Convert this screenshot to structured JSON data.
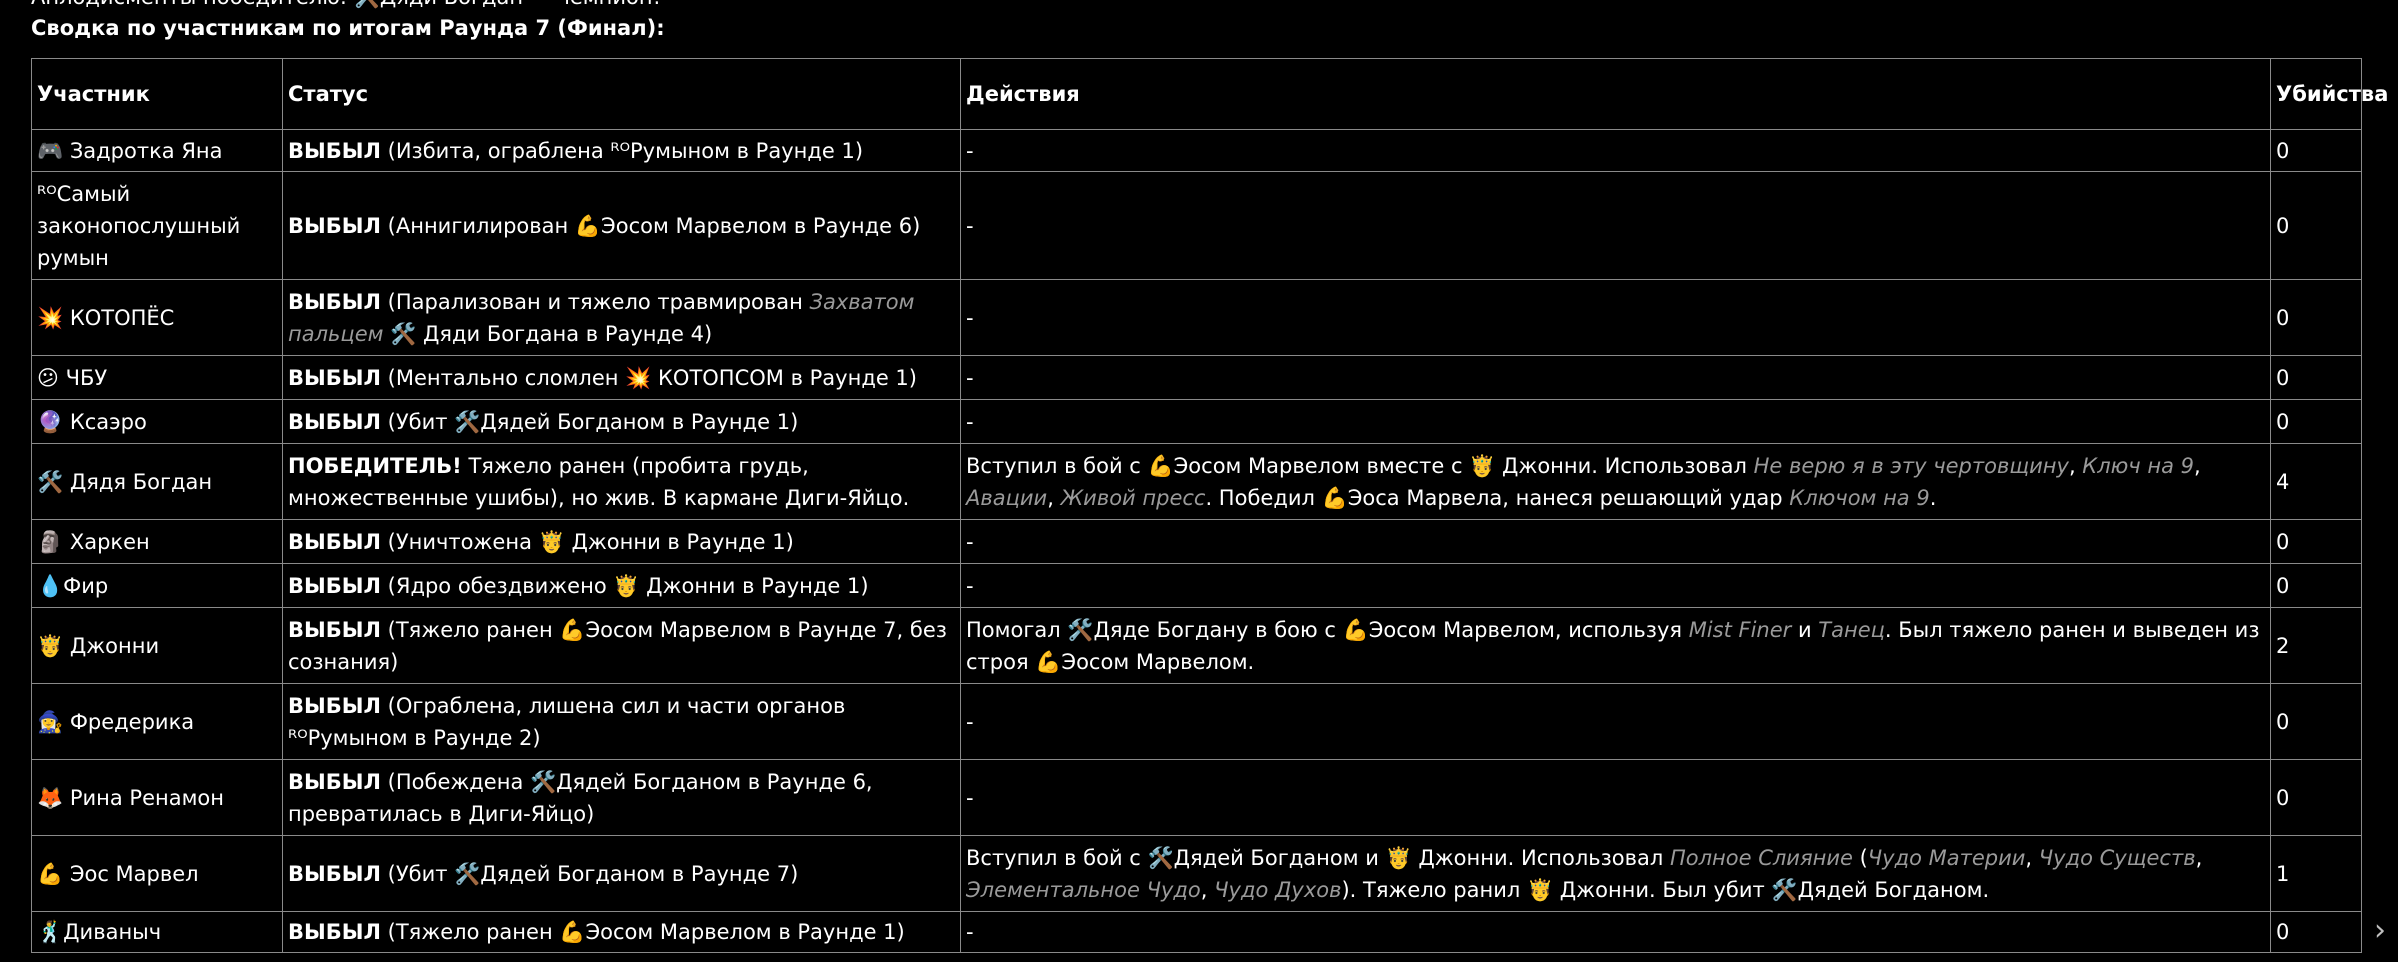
{
  "header": {
    "top_line": "Аплодисменты победителю: 🛠️Дяди Богдан — чемпион!",
    "summary_title": "Сводка по участникам по итогам Раунда 7 (Финал):"
  },
  "table": {
    "columns": [
      "Участник",
      "Статус",
      "Действия",
      "Убийства"
    ],
    "rows": [
      {
        "name": "🎮 Задротка Яна",
        "status": [
          {
            "t": "ВЫБЫЛ",
            "s": "b"
          },
          {
            "t": " (Избита, ограблена ᴿᴼРумыном в Раунде 1)",
            "s": ""
          }
        ],
        "actions": [
          {
            "t": "-",
            "s": ""
          }
        ],
        "kills": "0"
      },
      {
        "name": "ᴿᴼСамый законопослушный румын",
        "status": [
          {
            "t": "ВЫБЫЛ",
            "s": "b"
          },
          {
            "t": " (Аннигилирован 💪Эосом Марвелом в Раунде 6)",
            "s": ""
          }
        ],
        "actions": [
          {
            "t": "-",
            "s": ""
          }
        ],
        "kills": "0"
      },
      {
        "name": "💥 КОТОПЁС",
        "status": [
          {
            "t": "ВЫБЫЛ",
            "s": "b"
          },
          {
            "t": " (Парализован и тяжело травмирован ",
            "s": ""
          },
          {
            "t": "Захватом пальцем",
            "s": "i"
          },
          {
            "t": " 🛠️ Дяди Богдана в Раунде 4)",
            "s": ""
          }
        ],
        "actions": [
          {
            "t": "-",
            "s": ""
          }
        ],
        "kills": "0"
      },
      {
        "name": "😕 ЧБУ",
        "status": [
          {
            "t": "ВЫБЫЛ",
            "s": "b"
          },
          {
            "t": " (Ментально сломлен 💥 КОТОПСОМ в Раунде 1)",
            "s": ""
          }
        ],
        "actions": [
          {
            "t": "-",
            "s": ""
          }
        ],
        "kills": "0"
      },
      {
        "name": "🔮 Ксаэро",
        "status": [
          {
            "t": "ВЫБЫЛ",
            "s": "b"
          },
          {
            "t": " (Убит 🛠️Дядей Богданом в Раунде 1)",
            "s": ""
          }
        ],
        "actions": [
          {
            "t": "-",
            "s": ""
          }
        ],
        "kills": "0"
      },
      {
        "name": "🛠️ Дядя Богдан",
        "status": [
          {
            "t": "ПОБЕДИТЕЛЬ!",
            "s": "b"
          },
          {
            "t": " Тяжело ранен (пробита грудь, множественные ушибы), но жив. В кармане Диги-Яйцо.",
            "s": ""
          }
        ],
        "actions": [
          {
            "t": "Вступил в бой с 💪Эосом Марвелом вместе с 🤴 Джонни. Использовал ",
            "s": ""
          },
          {
            "t": "Не верю я в эту чертовщину",
            "s": "i"
          },
          {
            "t": ", ",
            "s": ""
          },
          {
            "t": "Ключ на 9",
            "s": "i"
          },
          {
            "t": ", ",
            "s": ""
          },
          {
            "t": "Авации",
            "s": "i"
          },
          {
            "t": ", ",
            "s": ""
          },
          {
            "t": "Живой пресс",
            "s": "i"
          },
          {
            "t": ". Победил 💪Эоса Марвела, нанеся решающий удар ",
            "s": ""
          },
          {
            "t": "Ключом на 9",
            "s": "i"
          },
          {
            "t": ".",
            "s": ""
          }
        ],
        "kills": "4"
      },
      {
        "name": "🗿 Харкен",
        "status": [
          {
            "t": "ВЫБЫЛ",
            "s": "b"
          },
          {
            "t": " (Уничтожена 🤴 Джонни в Раунде 1)",
            "s": ""
          }
        ],
        "actions": [
          {
            "t": "-",
            "s": ""
          }
        ],
        "kills": "0"
      },
      {
        "name": "💧Фир",
        "status": [
          {
            "t": "ВЫБЫЛ",
            "s": "b"
          },
          {
            "t": " (Ядро обездвижено 🤴 Джонни в Раунде 1)",
            "s": ""
          }
        ],
        "actions": [
          {
            "t": "-",
            "s": ""
          }
        ],
        "kills": "0"
      },
      {
        "name": "🤴 Джонни",
        "status": [
          {
            "t": "ВЫБЫЛ",
            "s": "b"
          },
          {
            "t": " (Тяжело ранен 💪Эосом Марвелом в Раунде 7, без сознания)",
            "s": ""
          }
        ],
        "actions": [
          {
            "t": "Помогал 🛠️Дяде Богдану в бою с 💪Эосом Марвелом, используя ",
            "s": ""
          },
          {
            "t": "Mist Finer",
            "s": "i"
          },
          {
            "t": " и ",
            "s": ""
          },
          {
            "t": "Танец",
            "s": "i"
          },
          {
            "t": ". Был тяжело ранен и выведен из строя 💪Эосом Марвелом.",
            "s": ""
          }
        ],
        "kills": "2"
      },
      {
        "name": "🧙‍♀️ Фредерика",
        "status": [
          {
            "t": "ВЫБЫЛ",
            "s": "b"
          },
          {
            "t": " (Ограблена, лишена сил и части органов ᴿᴼРумыном в Раунде 2)",
            "s": ""
          }
        ],
        "actions": [
          {
            "t": "-",
            "s": ""
          }
        ],
        "kills": "0"
      },
      {
        "name": "🦊 Рина Ренамон",
        "status": [
          {
            "t": "ВЫБЫЛ",
            "s": "b"
          },
          {
            "t": " (Побеждена 🛠️Дядей Богданом в Раунде 6, превратилась в Диги-Яйцо)",
            "s": ""
          }
        ],
        "actions": [
          {
            "t": "-",
            "s": ""
          }
        ],
        "kills": "0"
      },
      {
        "name": "💪 Эос Марвел",
        "status": [
          {
            "t": "ВЫБЫЛ",
            "s": "b"
          },
          {
            "t": " (Убит 🛠️Дядей Богданом в Раунде 7)",
            "s": ""
          }
        ],
        "actions": [
          {
            "t": "Вступил в бой с 🛠️Дядей Богданом и 🤴 Джонни. Использовал ",
            "s": ""
          },
          {
            "t": "Полное Слияние",
            "s": "i"
          },
          {
            "t": " (",
            "s": ""
          },
          {
            "t": "Чудо Материи",
            "s": "i"
          },
          {
            "t": ", ",
            "s": ""
          },
          {
            "t": "Чудо Существ",
            "s": "i"
          },
          {
            "t": ", ",
            "s": ""
          },
          {
            "t": "Элементальное Чудо",
            "s": "i"
          },
          {
            "t": ", ",
            "s": ""
          },
          {
            "t": "Чудо Духов",
            "s": "i"
          },
          {
            "t": "). Тяжело ранил 🤴 Джонни. Был убит 🛠️Дядей Богданом.",
            "s": ""
          }
        ],
        "kills": "1"
      },
      {
        "name": "🕺Диваныч",
        "status": [
          {
            "t": "ВЫБЫЛ",
            "s": "b"
          },
          {
            "t": " (Тяжело ранен 💪Эосом Марвелом в Раунде 1)",
            "s": ""
          }
        ],
        "actions": [
          {
            "t": "-",
            "s": ""
          }
        ],
        "kills": "0"
      }
    ]
  },
  "ui": {
    "scroll_right_icon": "chevron-right-icon",
    "border_color": "#8a8a8a",
    "italic_color": "#9a9a9a",
    "background": "#000000",
    "text_color": "#ffffff"
  }
}
